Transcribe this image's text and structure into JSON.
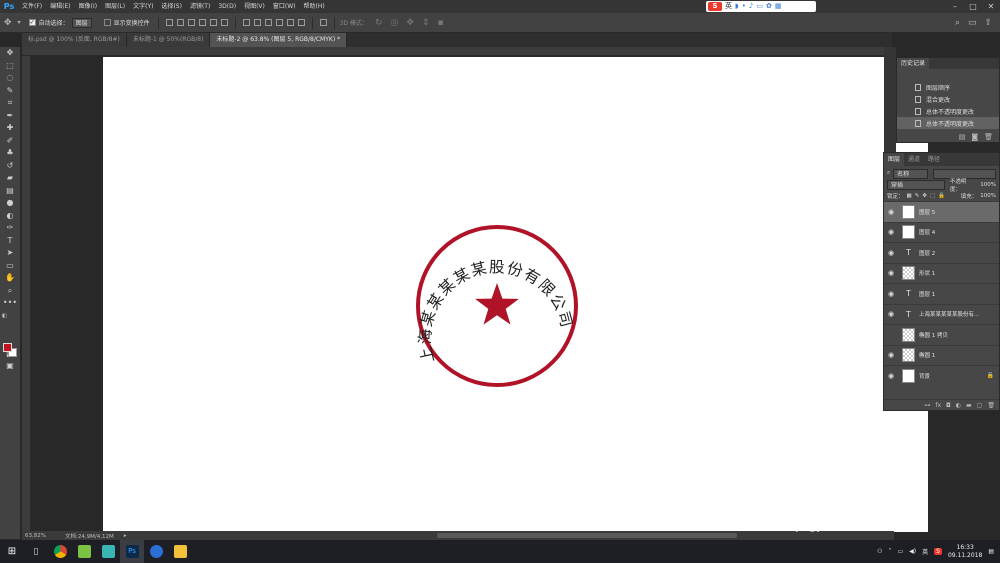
{
  "menubar": {
    "app_logo": "Ps",
    "items": [
      "文件(F)",
      "编辑(E)",
      "图像(I)",
      "图层(L)",
      "文字(Y)",
      "选择(S)",
      "滤镜(T)",
      "3D(D)",
      "视图(V)",
      "窗口(W)",
      "帮助(H)"
    ],
    "ime_mode": "英"
  },
  "options": {
    "auto_select_label": "自动选择：",
    "auto_select_value": "图层",
    "show_transform_label": "显示变换控件",
    "mode_3d_label": "3D 模式："
  },
  "tabs": [
    {
      "label": "标.psd @ 100% (反面, RGB/8#)",
      "active": false
    },
    {
      "label": "未标题-1 @ 50%(RGB/8)",
      "active": false
    },
    {
      "label": "未标题-2 @ 63.8% (图层 5, RGB/8/CMYK) *",
      "active": true
    }
  ],
  "status": {
    "zoom": "63,82%",
    "doc": "文档:24,9M/4,12M"
  },
  "stamp": {
    "text": "上海某某某某某股份有限公司",
    "color": "#b01227"
  },
  "history": {
    "title": "历史记录",
    "items": [
      {
        "label": "图层顺序",
        "selected": false
      },
      {
        "label": "混合更改",
        "selected": false
      },
      {
        "label": "总体不透明度更改",
        "selected": false
      },
      {
        "label": "总体不透明度更改",
        "selected": true
      }
    ]
  },
  "layers_panel": {
    "tabs": [
      "图层",
      "通道",
      "路径"
    ],
    "filter_label": "名称",
    "blend_mode": "穿插",
    "opacity_label": "不透明度：",
    "opacity_value": "100%",
    "lock_label": "锁定：",
    "fill_label": "填充：",
    "fill_value": "100%",
    "layers": [
      {
        "name": "图层 5",
        "thumb": "white",
        "visible": true,
        "selected": true
      },
      {
        "name": "图层 4",
        "thumb": "white",
        "visible": true,
        "selected": false
      },
      {
        "name": "图层 2",
        "thumb": "T",
        "visible": true,
        "selected": false
      },
      {
        "name": "形状 1",
        "thumb": "check",
        "visible": true,
        "selected": false
      },
      {
        "name": "图层 1",
        "thumb": "T",
        "visible": true,
        "selected": false
      },
      {
        "name": "上海某某某某某股份有...",
        "thumb": "T",
        "visible": true,
        "selected": false
      },
      {
        "name": "椭圆 1 拷贝",
        "thumb": "check",
        "visible": false,
        "selected": false
      },
      {
        "name": "椭圆 1",
        "thumb": "check",
        "visible": true,
        "selected": false
      },
      {
        "name": "背景",
        "thumb": "white",
        "visible": true,
        "selected": false,
        "locked": true
      }
    ]
  },
  "taskbar": {
    "time": "16:33",
    "date": "09.11.2018",
    "ime": "英",
    "apps": [
      "chrome",
      "app-green",
      "app-teal",
      "photoshop",
      "app-blue",
      "file-explorer"
    ]
  },
  "watermark": {
    "brand": "Bai 经验",
    "url": "jingyan.baidu.com"
  }
}
